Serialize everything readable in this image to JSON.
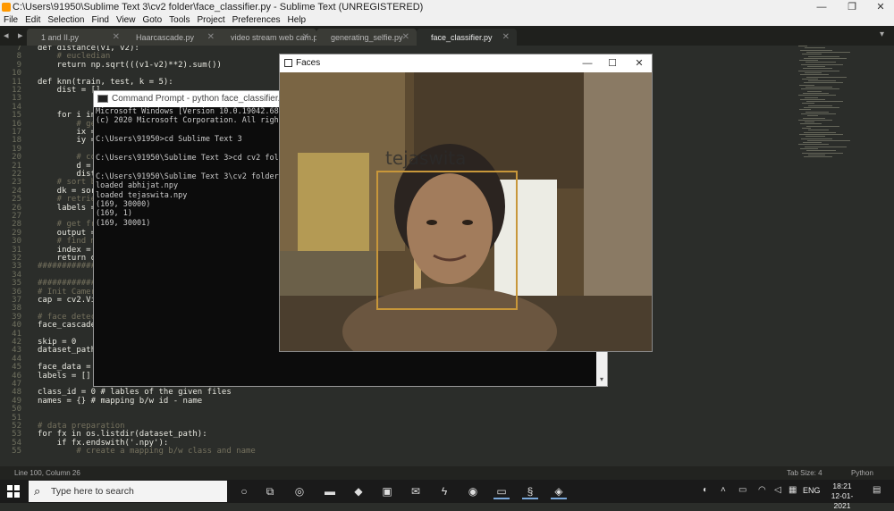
{
  "sublime": {
    "title": "C:\\Users\\91950\\Sublime Text 3\\cv2 folder\\face_classifier.py - Sublime Text (UNREGISTERED)",
    "menu": [
      "File",
      "Edit",
      "Selection",
      "Find",
      "View",
      "Goto",
      "Tools",
      "Project",
      "Preferences",
      "Help"
    ],
    "tabs": [
      "1 and II.py",
      "Haarcascade.py",
      "video stream web cam.py",
      "generating_selfie.py",
      "face_classifier.py"
    ],
    "active_tab": "face_classifier.py",
    "status_left": "Line 100, Column 26",
    "status_tab": "Tab Size: 4",
    "status_lang": "Python"
  },
  "code_lines": [
    {
      "n": "7",
      "text": "def distance(v1, v2):"
    },
    {
      "n": "8",
      "text": "    # eucledian",
      "comment": true
    },
    {
      "n": "9",
      "text": "    return np.sqrt(((v1-v2)**2).sum())"
    },
    {
      "n": "10",
      "text": ""
    },
    {
      "n": "11",
      "text": "def knn(train, test, k = 5):"
    },
    {
      "n": "12",
      "text": "    dist = []"
    },
    {
      "n": "13",
      "text": ""
    },
    {
      "n": "14",
      "text": ""
    },
    {
      "n": "15",
      "text": "    for i in"
    },
    {
      "n": "16",
      "text": "        # get",
      "comment": true
    },
    {
      "n": "17",
      "text": "        ix ="
    },
    {
      "n": "18",
      "text": "        iy ="
    },
    {
      "n": "19",
      "text": ""
    },
    {
      "n": "20",
      "text": "        # com",
      "comment": true
    },
    {
      "n": "21",
      "text": "        d = d"
    },
    {
      "n": "22",
      "text": "        dist."
    },
    {
      "n": "23",
      "text": "    # sort ba",
      "comment": true
    },
    {
      "n": "24",
      "text": "    dk = sort"
    },
    {
      "n": "25",
      "text": "    # retriev",
      "comment": true
    },
    {
      "n": "26",
      "text": "    labels ="
    },
    {
      "n": "27",
      "text": ""
    },
    {
      "n": "28",
      "text": "    # get fre",
      "comment": true
    },
    {
      "n": "29",
      "text": "    output ="
    },
    {
      "n": "30",
      "text": "    # find ma",
      "comment": true
    },
    {
      "n": "31",
      "text": "    index = n"
    },
    {
      "n": "32",
      "text": "    return ou"
    },
    {
      "n": "33",
      "text": "##############",
      "comment": true
    },
    {
      "n": "34",
      "text": ""
    },
    {
      "n": "35",
      "text": "##############",
      "comment": true
    },
    {
      "n": "36",
      "text": "# Init Camera",
      "comment": true
    },
    {
      "n": "37",
      "text": "cap = cv2.Vid"
    },
    {
      "n": "38",
      "text": ""
    },
    {
      "n": "39",
      "text": "# face detect",
      "comment": true
    },
    {
      "n": "40",
      "text": "face_cascade"
    },
    {
      "n": "41",
      "text": ""
    },
    {
      "n": "42",
      "text": "skip = 0"
    },
    {
      "n": "43",
      "text": "dataset_path"
    },
    {
      "n": "44",
      "text": ""
    },
    {
      "n": "45",
      "text": "face_data = ["
    },
    {
      "n": "46",
      "text": "labels = []"
    },
    {
      "n": "47",
      "text": ""
    },
    {
      "n": "48",
      "text": "class_id = 0 # lables of the given files"
    },
    {
      "n": "49",
      "text": "names = {} # mapping b/w id - name"
    },
    {
      "n": "50",
      "text": ""
    },
    {
      "n": "51",
      "text": ""
    },
    {
      "n": "52",
      "text": "# data preparation",
      "comment": true
    },
    {
      "n": "53",
      "text": "for fx in os.listdir(dataset_path):"
    },
    {
      "n": "54",
      "text": "    if fx.endswith('.npy'):"
    },
    {
      "n": "55",
      "text": "        # create a mapping b/w class and name",
      "comment": true
    }
  ],
  "cmd": {
    "title": "Command Prompt - python  face_classifier.py",
    "lines": [
      "Microsoft Windows [Version 10.0.19042.685]",
      "(c) 2020 Microsoft Corporation. All rights r",
      "",
      "C:\\Users\\91950>cd Sublime Text 3",
      "",
      "C:\\Users\\91950\\Sublime Text 3>cd cv2 folder",
      "",
      "C:\\Users\\91950\\Sublime Text 3\\cv2 folder>pyt",
      "loaded abhijat.npy",
      "loaded tejaswita.npy",
      "(169, 30000)",
      "(169, 1)",
      "(169, 30001)"
    ]
  },
  "faces": {
    "title": "Faces",
    "label": "tejaswita"
  },
  "taskbar": {
    "search_placeholder": "Type here to search",
    "lang": "ENG",
    "time": "18:21",
    "date": "12-01-2021"
  }
}
